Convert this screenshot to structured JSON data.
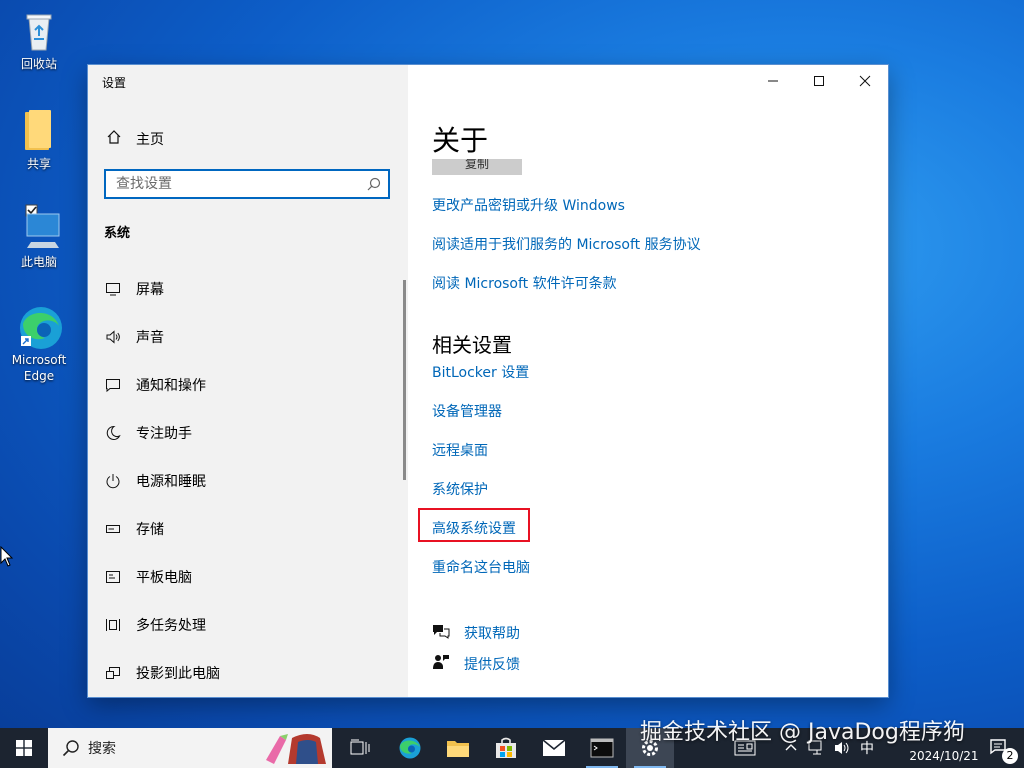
{
  "desktop": {
    "icons": [
      {
        "label": "回收站"
      },
      {
        "label": "共享"
      },
      {
        "label": "此电脑"
      },
      {
        "label": "Microsoft Edge"
      }
    ]
  },
  "window": {
    "title": "设置",
    "controls": {
      "minimize": "minimize-icon",
      "maximize": "maximize-icon",
      "close": "close-icon"
    }
  },
  "sidebar": {
    "home_label": "主页",
    "search_placeholder": "查找设置",
    "section_title": "系统",
    "items": [
      {
        "label": "屏幕",
        "icon": "monitor-icon"
      },
      {
        "label": "声音",
        "icon": "speaker-icon"
      },
      {
        "label": "通知和操作",
        "icon": "notification-icon"
      },
      {
        "label": "专注助手",
        "icon": "moon-icon"
      },
      {
        "label": "电源和睡眠",
        "icon": "power-icon"
      },
      {
        "label": "存储",
        "icon": "storage-icon"
      },
      {
        "label": "平板电脑",
        "icon": "tablet-icon"
      },
      {
        "label": "多任务处理",
        "icon": "multitask-icon"
      },
      {
        "label": "投影到此电脑",
        "icon": "project-icon"
      }
    ]
  },
  "main": {
    "title": "关于",
    "copy_button": "复制",
    "links": [
      "更改产品密钥或升级 Windows",
      "阅读适用于我们服务的 Microsoft 服务协议",
      "阅读 Microsoft 软件许可条款"
    ],
    "related_title": "相关设置",
    "related_links": [
      "BitLocker 设置",
      "设备管理器",
      "远程桌面",
      "系统保护",
      "高级系统设置",
      "重命名这台电脑"
    ],
    "help": [
      {
        "label": "获取帮助",
        "icon": "help-chat-icon"
      },
      {
        "label": "提供反馈",
        "icon": "feedback-icon"
      }
    ]
  },
  "taskbar": {
    "search_label": "搜索",
    "ime": "中",
    "date": "2024/10/21",
    "notification_count": "2"
  },
  "watermark": "掘金技术社区 @ JavaDog程序狗",
  "colors": {
    "accent": "#0067b8",
    "highlight": "#e81123",
    "taskbar": "#1c2430"
  }
}
